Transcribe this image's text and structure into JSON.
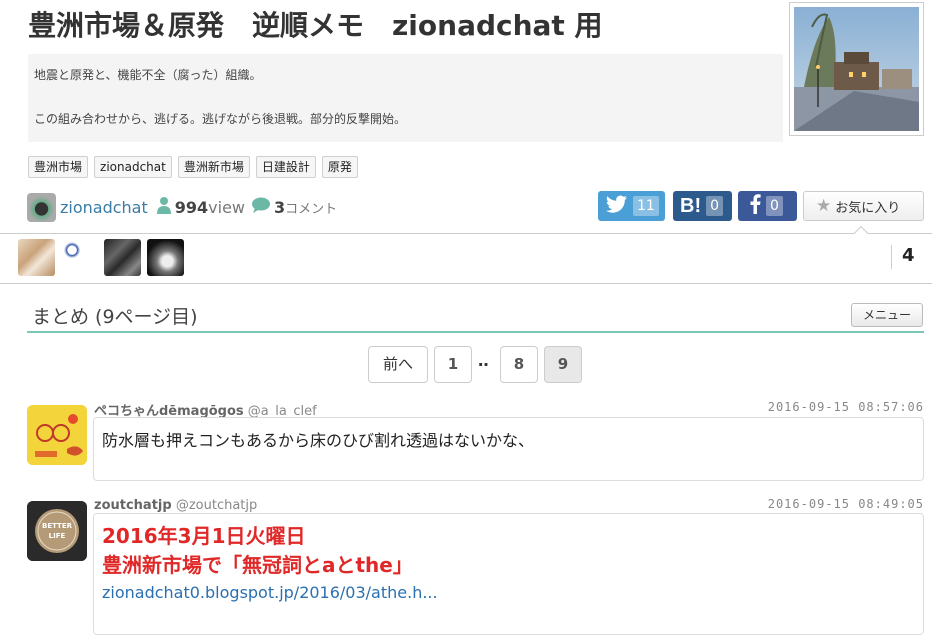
{
  "header": {
    "title": "豊洲市場＆原発　逆順メモ　zionadchat 用",
    "description_line1": "地震と原発と、機能不全（腐った）組織。",
    "description_line2": "この組み合わせから、逃げる。逃げながら後退戦。部分的反撃開始。"
  },
  "tags": [
    "豊洲市場",
    "zionadchat",
    "豊洲新市場",
    "日建設計",
    "原発"
  ],
  "author": {
    "name": "zionadchat",
    "views": "994",
    "views_unit": "view",
    "comments": "3",
    "comments_unit": "コメント"
  },
  "share": {
    "twitter_count": "11",
    "hatena_label": "B!",
    "hatena_count": "0",
    "facebook_count": "0",
    "favorite_label": "お気に入り"
  },
  "favorites": {
    "count": "4"
  },
  "section": {
    "title": "まとめ (9ページ目)",
    "menu_label": "メニュー"
  },
  "pager": {
    "prev": "前へ",
    "pages": [
      "1",
      "8",
      "9"
    ],
    "ellipsis": "‥",
    "current": "9"
  },
  "tweets": [
    {
      "name": "ペコちゃんdēmagōgos",
      "handle": "@a_la_clef",
      "time": "2016-09-15 08:57:06",
      "text": "防水層も押えコンもあるから床のひび割れ透過はないかな、"
    },
    {
      "name": "zoutchatjp",
      "handle": "@zoutchatjp",
      "time": "2016-09-15 08:49:05",
      "line1": "2016年3月1日火曜日",
      "line2": "豊洲新市場で「無冠詞とaとthe」",
      "link": "zionadchat0.blogspot.jp/2016/03/athe.h...",
      "avatar_text_top": "BETTER",
      "avatar_text_bottom": "LIFE"
    }
  ],
  "colors": {
    "twitter": "#4a9fd6",
    "hatena": "#2c5a8c",
    "facebook": "#3b5998",
    "accent_line": "#7cc8b8",
    "red_text": "#e02828",
    "link": "#2a6fb0"
  }
}
